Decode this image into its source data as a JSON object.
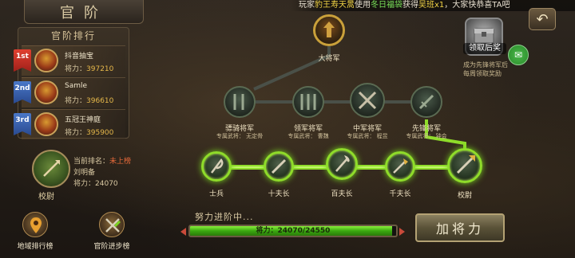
{
  "title": "官阶",
  "banner": {
    "prefix": "玩家",
    "player": "豹王寿天暠",
    "mid1": "使用",
    "item": "冬日福袋",
    "mid2": "获得",
    "reward": "吴班x1",
    "suffix": "，大家快恭喜TA吧"
  },
  "ranking": {
    "heading": "官阶排行",
    "entries": [
      {
        "badge": "1st",
        "name": "抖音抽宝",
        "power_label": "将力：",
        "power": "397210"
      },
      {
        "badge": "2nd",
        "name": "Samle",
        "power_label": "将力：",
        "power": "396610"
      },
      {
        "badge": "3rd",
        "name": "五冠王神庭",
        "power_label": "将力：",
        "power": "395900"
      }
    ]
  },
  "me": {
    "rank_title": "校尉",
    "rank_label": "当前排名：",
    "rank_value": "未上榜",
    "name": "刘明备",
    "power_label": "将力：",
    "power": "24070"
  },
  "bottom_buttons": [
    {
      "label": "地域排行榜",
      "icon": "map-pin-icon"
    },
    {
      "label": "官阶进步榜",
      "icon": "crossed-swords-icon"
    }
  ],
  "reward": {
    "label": "领取后奖",
    "note_line1": "成为先锋将军后",
    "note_line2": "每周领取奖励"
  },
  "tree": {
    "top": {
      "label": "大将军"
    },
    "generals": [
      {
        "label": "骠骑将军",
        "sub": "专属武将：  无定骨"
      },
      {
        "label": "领军将军",
        "sub": "专属武将：  曹魏"
      },
      {
        "label": "中军将军",
        "sub": "专属武将：  程昱"
      },
      {
        "label": "先锋将军",
        "sub": "专属武将：  钟会"
      }
    ],
    "ranks": [
      {
        "label": "士兵",
        "state": "lit"
      },
      {
        "label": "十夫长",
        "state": "lit"
      },
      {
        "label": "百夫长",
        "state": "lit"
      },
      {
        "label": "千夫长",
        "state": "lit"
      },
      {
        "label": "校尉",
        "state": "current"
      }
    ]
  },
  "progress": {
    "title": "努力进阶中...",
    "text": "将力：24070/24550",
    "current": 24070,
    "max": 24550
  },
  "promote_button": "加将力",
  "colors": {
    "lit_border": "#8fdc2a",
    "accent_gold": "#e6b84a",
    "banner_yellow": "#f2d445",
    "banner_green": "#7be35a"
  }
}
